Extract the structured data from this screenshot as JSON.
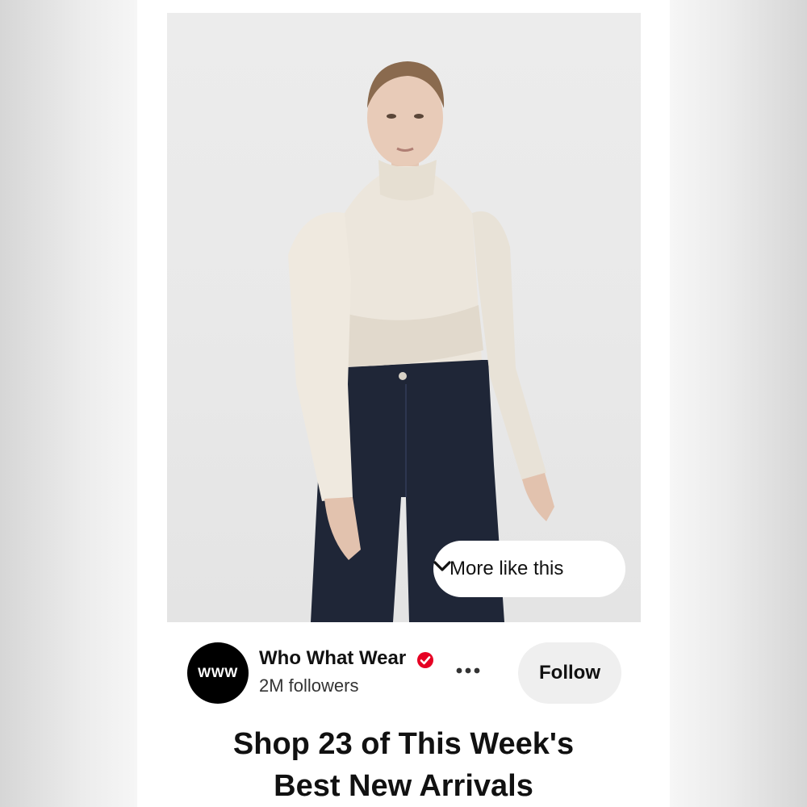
{
  "pin": {
    "image_alt": "Model wearing cream satin high-neck blouse and dark wide-leg jeans",
    "more_like_this_label": "More like this"
  },
  "creator": {
    "avatar_text": "WWW",
    "name": "Who What Wear",
    "followers": "2M followers",
    "follow_label": "Follow"
  },
  "title": {
    "line1": "Shop 23 of This Week's",
    "line2": "Best New Arrivals"
  },
  "colors": {
    "verified": "#e60023",
    "follow_bg": "#efefef",
    "blouse": "#ece6dc",
    "jeans": "#1f2637"
  },
  "icons": {
    "verified": "verified-check-icon",
    "more": "ellipsis-icon",
    "chevron": "chevron-down-icon"
  }
}
